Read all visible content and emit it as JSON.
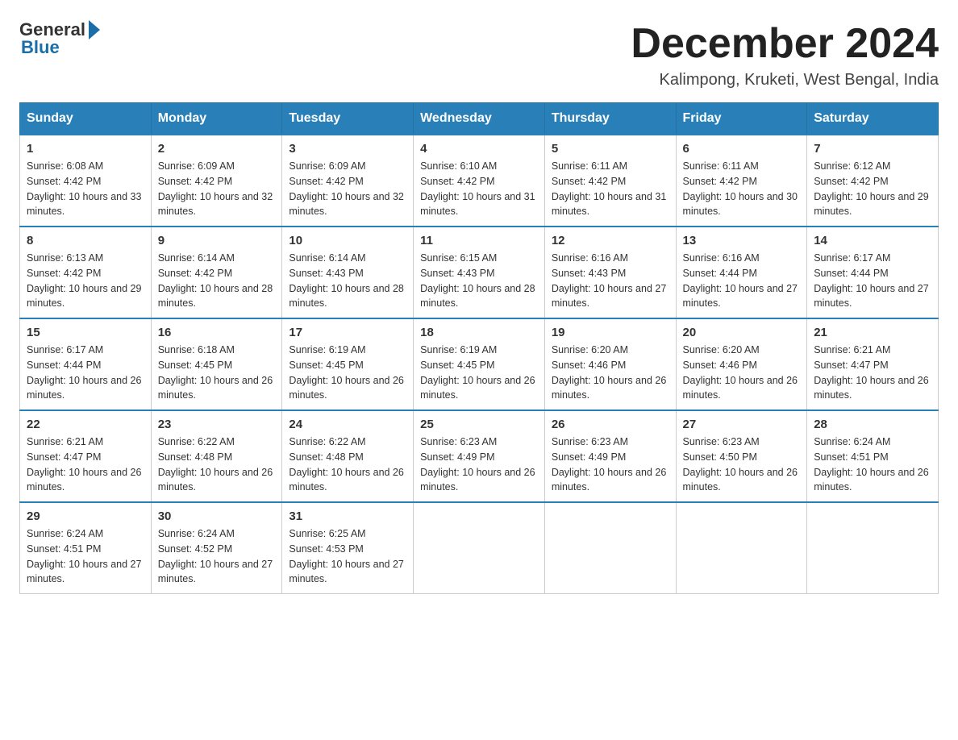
{
  "header": {
    "logo_general": "General",
    "logo_blue": "Blue",
    "month_title": "December 2024",
    "location": "Kalimpong, Kruketi, West Bengal, India"
  },
  "days_of_week": [
    "Sunday",
    "Monday",
    "Tuesday",
    "Wednesday",
    "Thursday",
    "Friday",
    "Saturday"
  ],
  "weeks": [
    [
      {
        "day": "1",
        "sunrise": "6:08 AM",
        "sunset": "4:42 PM",
        "daylight": "10 hours and 33 minutes."
      },
      {
        "day": "2",
        "sunrise": "6:09 AM",
        "sunset": "4:42 PM",
        "daylight": "10 hours and 32 minutes."
      },
      {
        "day": "3",
        "sunrise": "6:09 AM",
        "sunset": "4:42 PM",
        "daylight": "10 hours and 32 minutes."
      },
      {
        "day": "4",
        "sunrise": "6:10 AM",
        "sunset": "4:42 PM",
        "daylight": "10 hours and 31 minutes."
      },
      {
        "day": "5",
        "sunrise": "6:11 AM",
        "sunset": "4:42 PM",
        "daylight": "10 hours and 31 minutes."
      },
      {
        "day": "6",
        "sunrise": "6:11 AM",
        "sunset": "4:42 PM",
        "daylight": "10 hours and 30 minutes."
      },
      {
        "day": "7",
        "sunrise": "6:12 AM",
        "sunset": "4:42 PM",
        "daylight": "10 hours and 29 minutes."
      }
    ],
    [
      {
        "day": "8",
        "sunrise": "6:13 AM",
        "sunset": "4:42 PM",
        "daylight": "10 hours and 29 minutes."
      },
      {
        "day": "9",
        "sunrise": "6:14 AM",
        "sunset": "4:42 PM",
        "daylight": "10 hours and 28 minutes."
      },
      {
        "day": "10",
        "sunrise": "6:14 AM",
        "sunset": "4:43 PM",
        "daylight": "10 hours and 28 minutes."
      },
      {
        "day": "11",
        "sunrise": "6:15 AM",
        "sunset": "4:43 PM",
        "daylight": "10 hours and 28 minutes."
      },
      {
        "day": "12",
        "sunrise": "6:16 AM",
        "sunset": "4:43 PM",
        "daylight": "10 hours and 27 minutes."
      },
      {
        "day": "13",
        "sunrise": "6:16 AM",
        "sunset": "4:44 PM",
        "daylight": "10 hours and 27 minutes."
      },
      {
        "day": "14",
        "sunrise": "6:17 AM",
        "sunset": "4:44 PM",
        "daylight": "10 hours and 27 minutes."
      }
    ],
    [
      {
        "day": "15",
        "sunrise": "6:17 AM",
        "sunset": "4:44 PM",
        "daylight": "10 hours and 26 minutes."
      },
      {
        "day": "16",
        "sunrise": "6:18 AM",
        "sunset": "4:45 PM",
        "daylight": "10 hours and 26 minutes."
      },
      {
        "day": "17",
        "sunrise": "6:19 AM",
        "sunset": "4:45 PM",
        "daylight": "10 hours and 26 minutes."
      },
      {
        "day": "18",
        "sunrise": "6:19 AM",
        "sunset": "4:45 PM",
        "daylight": "10 hours and 26 minutes."
      },
      {
        "day": "19",
        "sunrise": "6:20 AM",
        "sunset": "4:46 PM",
        "daylight": "10 hours and 26 minutes."
      },
      {
        "day": "20",
        "sunrise": "6:20 AM",
        "sunset": "4:46 PM",
        "daylight": "10 hours and 26 minutes."
      },
      {
        "day": "21",
        "sunrise": "6:21 AM",
        "sunset": "4:47 PM",
        "daylight": "10 hours and 26 minutes."
      }
    ],
    [
      {
        "day": "22",
        "sunrise": "6:21 AM",
        "sunset": "4:47 PM",
        "daylight": "10 hours and 26 minutes."
      },
      {
        "day": "23",
        "sunrise": "6:22 AM",
        "sunset": "4:48 PM",
        "daylight": "10 hours and 26 minutes."
      },
      {
        "day": "24",
        "sunrise": "6:22 AM",
        "sunset": "4:48 PM",
        "daylight": "10 hours and 26 minutes."
      },
      {
        "day": "25",
        "sunrise": "6:23 AM",
        "sunset": "4:49 PM",
        "daylight": "10 hours and 26 minutes."
      },
      {
        "day": "26",
        "sunrise": "6:23 AM",
        "sunset": "4:49 PM",
        "daylight": "10 hours and 26 minutes."
      },
      {
        "day": "27",
        "sunrise": "6:23 AM",
        "sunset": "4:50 PM",
        "daylight": "10 hours and 26 minutes."
      },
      {
        "day": "28",
        "sunrise": "6:24 AM",
        "sunset": "4:51 PM",
        "daylight": "10 hours and 26 minutes."
      }
    ],
    [
      {
        "day": "29",
        "sunrise": "6:24 AM",
        "sunset": "4:51 PM",
        "daylight": "10 hours and 27 minutes."
      },
      {
        "day": "30",
        "sunrise": "6:24 AM",
        "sunset": "4:52 PM",
        "daylight": "10 hours and 27 minutes."
      },
      {
        "day": "31",
        "sunrise": "6:25 AM",
        "sunset": "4:53 PM",
        "daylight": "10 hours and 27 minutes."
      },
      null,
      null,
      null,
      null
    ]
  ]
}
